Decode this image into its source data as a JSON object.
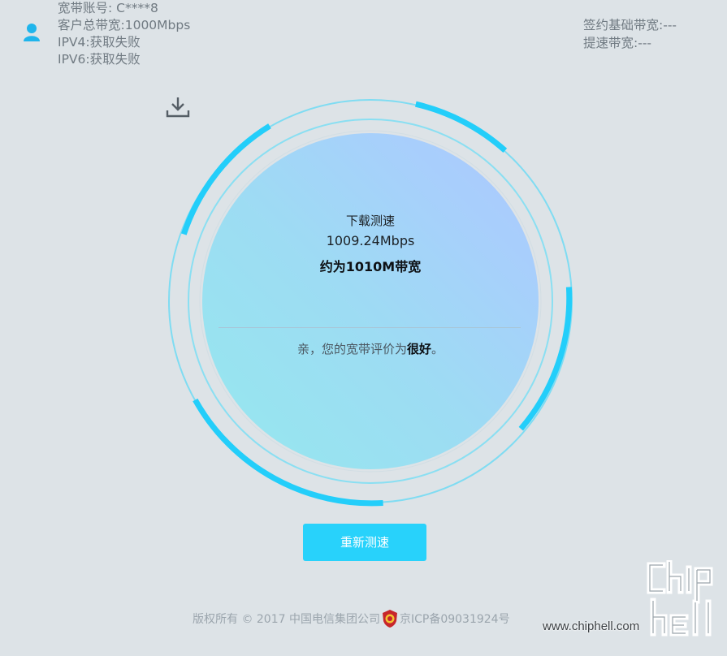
{
  "header": {
    "account": "宽带账号: C****8",
    "total_bandwidth": "客户总带宽:1000Mbps",
    "ipv4": "IPV4:获取失败",
    "ipv6": "IPV6:获取失败",
    "contract_bandwidth": "签约基础带宽:---",
    "boost_bandwidth": "提速带宽:---"
  },
  "result": {
    "title": "下载测速",
    "speed": "1009.24Mbps",
    "approx": "约为1010M带宽",
    "rating_prefix": "亲，您的宽带评价为",
    "rating_value": "很好",
    "rating_suffix": "。"
  },
  "actions": {
    "retest_label": "重新测速"
  },
  "footer": {
    "copyright": "版权所有 © 2017 中国电信集团公司",
    "icp": "京ICP备09031924号"
  },
  "watermark": {
    "url": "www.chiphell.com",
    "logo_text": "chip hell"
  },
  "icons": {
    "user": "user-icon",
    "download": "download-icon",
    "emblem": "police-emblem-icon"
  },
  "colors": {
    "accent": "#28d2fb",
    "background": "#dde3e7",
    "ring": "#7fdcf2"
  }
}
